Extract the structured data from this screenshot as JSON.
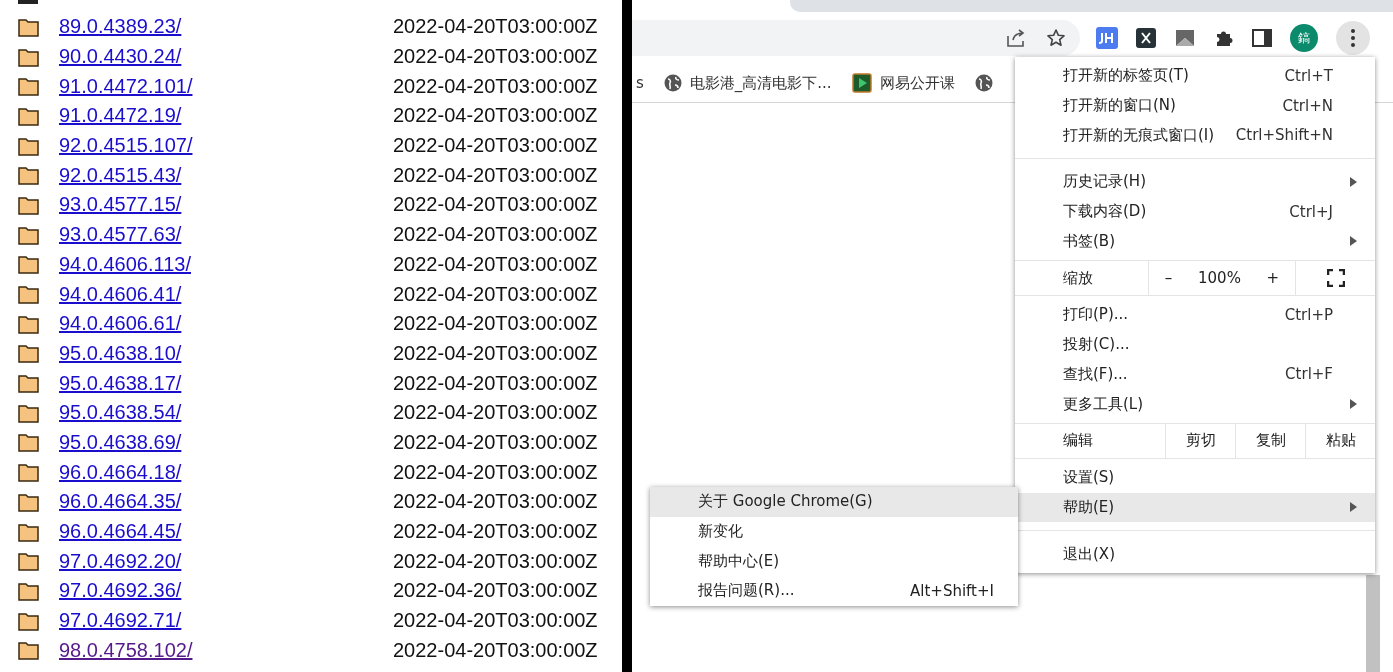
{
  "listing": {
    "rows": [
      {
        "name": "89.0.4389.23/",
        "date": "2022-04-20T03:00:00Z",
        "visited": false
      },
      {
        "name": "90.0.4430.24/",
        "date": "2022-04-20T03:00:00Z",
        "visited": false
      },
      {
        "name": "91.0.4472.101/",
        "date": "2022-04-20T03:00:00Z",
        "visited": false
      },
      {
        "name": "91.0.4472.19/",
        "date": "2022-04-20T03:00:00Z",
        "visited": false
      },
      {
        "name": "92.0.4515.107/",
        "date": "2022-04-20T03:00:00Z",
        "visited": false
      },
      {
        "name": "92.0.4515.43/",
        "date": "2022-04-20T03:00:00Z",
        "visited": false
      },
      {
        "name": "93.0.4577.15/",
        "date": "2022-04-20T03:00:00Z",
        "visited": false
      },
      {
        "name": "93.0.4577.63/",
        "date": "2022-04-20T03:00:00Z",
        "visited": false
      },
      {
        "name": "94.0.4606.113/",
        "date": "2022-04-20T03:00:00Z",
        "visited": false
      },
      {
        "name": "94.0.4606.41/",
        "date": "2022-04-20T03:00:00Z",
        "visited": false
      },
      {
        "name": "94.0.4606.61/",
        "date": "2022-04-20T03:00:00Z",
        "visited": false
      },
      {
        "name": "95.0.4638.10/",
        "date": "2022-04-20T03:00:00Z",
        "visited": false
      },
      {
        "name": "95.0.4638.17/",
        "date": "2022-04-20T03:00:00Z",
        "visited": false
      },
      {
        "name": "95.0.4638.54/",
        "date": "2022-04-20T03:00:00Z",
        "visited": false
      },
      {
        "name": "95.0.4638.69/",
        "date": "2022-04-20T03:00:00Z",
        "visited": false
      },
      {
        "name": "96.0.4664.18/",
        "date": "2022-04-20T03:00:00Z",
        "visited": false
      },
      {
        "name": "96.0.4664.35/",
        "date": "2022-04-20T03:00:00Z",
        "visited": false
      },
      {
        "name": "96.0.4664.45/",
        "date": "2022-04-20T03:00:00Z",
        "visited": false
      },
      {
        "name": "97.0.4692.20/",
        "date": "2022-04-20T03:00:00Z",
        "visited": false
      },
      {
        "name": "97.0.4692.36/",
        "date": "2022-04-20T03:00:00Z",
        "visited": false
      },
      {
        "name": "97.0.4692.71/",
        "date": "2022-04-20T03:00:00Z",
        "visited": false
      },
      {
        "name": "98.0.4758.102/",
        "date": "2022-04-20T03:00:00Z",
        "visited": true
      }
    ]
  },
  "browser": {
    "avatar": "鎬",
    "menu_open": true,
    "bookmarks": [
      {
        "kind": "text",
        "label": "s"
      },
      {
        "kind": "globe",
        "label": "电影港_高清电影下..."
      },
      {
        "kind": "play",
        "label": "网易公开课"
      },
      {
        "kind": "globe"
      }
    ],
    "menu": {
      "items": [
        {
          "kind": "item",
          "label": "打开新的标签页(T)",
          "shortcut": "Ctrl+T",
          "submenu": false,
          "selected": false
        },
        {
          "kind": "item",
          "label": "打开新的窗口(N)",
          "shortcut": "Ctrl+N",
          "submenu": false,
          "selected": false
        },
        {
          "kind": "item",
          "label": "打开新的无痕式窗口(I)",
          "shortcut": "Ctrl+Shift+N",
          "submenu": false,
          "selected": false
        },
        {
          "kind": "separator"
        },
        {
          "kind": "item",
          "label": "历史记录(H)",
          "submenu": true,
          "selected": false
        },
        {
          "kind": "item",
          "label": "下载内容(D)",
          "shortcut": "Ctrl+J",
          "submenu": false,
          "selected": false
        },
        {
          "kind": "item",
          "label": "书签(B)",
          "submenu": true,
          "selected": false
        },
        {
          "kind": "zoom",
          "label": "缩放",
          "minus": "–",
          "value": "100%",
          "plus": "+"
        },
        {
          "kind": "item",
          "label": "打印(P)...",
          "shortcut": "Ctrl+P",
          "submenu": false,
          "selected": false
        },
        {
          "kind": "item",
          "label": "投射(C)...",
          "submenu": false,
          "selected": false
        },
        {
          "kind": "item",
          "label": "查找(F)...",
          "shortcut": "Ctrl+F",
          "submenu": false,
          "selected": false
        },
        {
          "kind": "item",
          "label": "更多工具(L)",
          "submenu": true,
          "selected": false
        },
        {
          "kind": "edit",
          "label": "编辑",
          "actions": [
            "剪切",
            "复制",
            "粘贴"
          ]
        },
        {
          "kind": "item",
          "label": "设置(S)",
          "submenu": false,
          "selected": false
        },
        {
          "kind": "item",
          "label": "帮助(E)",
          "submenu": true,
          "selected": true
        },
        {
          "kind": "separator"
        },
        {
          "kind": "item",
          "label": "退出(X)",
          "submenu": false,
          "selected": false
        }
      ]
    },
    "help_menu": {
      "items": [
        {
          "label": "关于 Google Chrome(G)",
          "selected": true
        },
        {
          "label": "新变化",
          "selected": false
        },
        {
          "label": "帮助中心(E)",
          "selected": false
        },
        {
          "label": "报告问题(R)...",
          "shortcut": "Alt+Shift+I",
          "selected": false
        }
      ]
    }
  }
}
